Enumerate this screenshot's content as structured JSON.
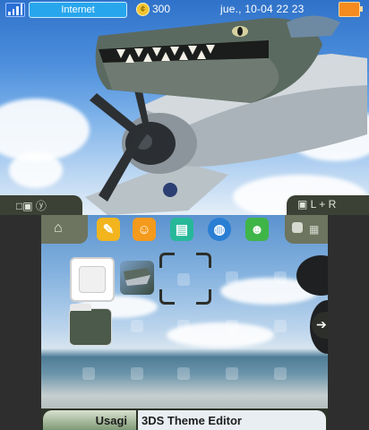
{
  "top_screen": {
    "status": {
      "connection": "Internet",
      "coins": "300",
      "datetime": "jue., 10-04   22 23"
    },
    "corner_left_hint": "□▣ ⓨ",
    "corner_right_hint": "▣ L + R"
  },
  "bottom_screen": {
    "apps": [
      {
        "name": "pencil",
        "color": "#f2b51e"
      },
      {
        "name": "mii",
        "color": "#f49a1c"
      },
      {
        "name": "messages",
        "color": "#27b89a"
      },
      {
        "name": "globe",
        "color": "#2a7ed3"
      },
      {
        "name": "friends",
        "color": "#3fb548"
      }
    ],
    "folder_label": "",
    "bottom_bar": {
      "user": "Usagi",
      "title": "3DS Theme Editor"
    }
  }
}
